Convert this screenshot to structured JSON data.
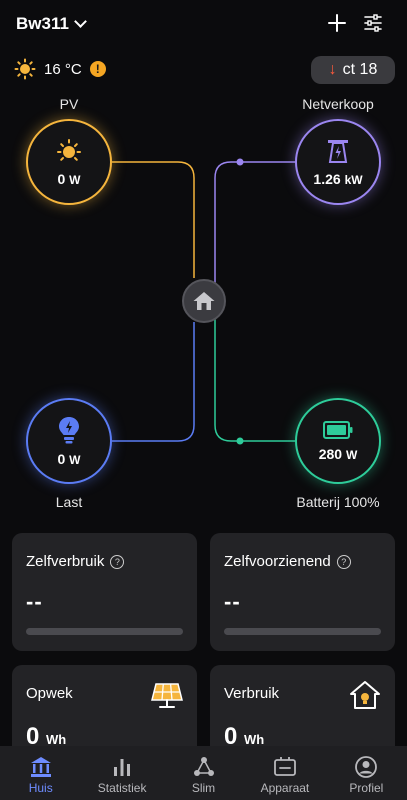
{
  "header": {
    "site": "Bw311"
  },
  "weather": {
    "temperature": "16 °C",
    "warning": "!"
  },
  "price": {
    "label": "ct 18"
  },
  "nodes": {
    "pv": {
      "label": "PV",
      "value": "0",
      "unit": "W"
    },
    "grid": {
      "label": "Netverkoop",
      "value": "1.26",
      "unit": "kW"
    },
    "load": {
      "label": "Last",
      "value": "0",
      "unit": "W"
    },
    "battery": {
      "label": "Batterij 100%",
      "value": "280",
      "unit": "W"
    }
  },
  "cards": {
    "self_use": {
      "title": "Zelfverbruik",
      "value": "--"
    },
    "self_sufficiency": {
      "title": "Zelfvoorzienend",
      "value": "--"
    },
    "generation": {
      "title": "Opwek",
      "value": "0",
      "unit": "Wh"
    },
    "consumption": {
      "title": "Verbruik",
      "value": "0",
      "unit": "Wh"
    }
  },
  "tabs": [
    {
      "label": "Huis",
      "icon": "home-icon"
    },
    {
      "label": "Statistiek",
      "icon": "stats-icon"
    },
    {
      "label": "Slim",
      "icon": "smart-icon"
    },
    {
      "label": "Apparaat",
      "icon": "device-icon"
    },
    {
      "label": "Profiel",
      "icon": "profile-icon"
    }
  ],
  "colors": {
    "pv": "#f5b53d",
    "grid": "#9b86f0",
    "load": "#5b7cf4",
    "battery": "#2ecc9a",
    "active_tab": "#6e8cff"
  }
}
